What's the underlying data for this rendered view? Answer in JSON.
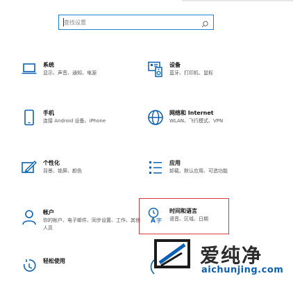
{
  "search": {
    "placeholder": "查找设置"
  },
  "tiles": [
    {
      "title": "系统",
      "desc": "显示、声音、通知、电源",
      "icon": "laptop-icon"
    },
    {
      "title": "设备",
      "desc": "蓝牙、打印机、鼠标",
      "icon": "devices-icon"
    },
    {
      "title": "手机",
      "desc": "连接 Android 设备、iPhone",
      "icon": "phone-icon"
    },
    {
      "title": "网络和 Internet",
      "desc": "WLAN、飞行模式、VPN",
      "icon": "globe-icon"
    },
    {
      "title": "个性化",
      "desc": "背景、锁屏、颜色",
      "icon": "personalization-icon"
    },
    {
      "title": "应用",
      "desc": "卸载、默认应用、可选功能",
      "icon": "apps-icon"
    },
    {
      "title": "帐户",
      "desc": "你的帐户、电子邮件、同步设置、工作、其他人员",
      "icon": "person-icon"
    },
    {
      "title": "时间和语言",
      "desc": "语音、区域、日期",
      "icon": "time-language-icon"
    },
    {
      "title": "轻松使用",
      "desc": "",
      "icon": "ease-of-access-icon"
    }
  ],
  "watermark": {
    "brand": "爱纯净",
    "url": "aichunjing.com"
  },
  "colors": {
    "accent": "#0a61b4",
    "highlight": "#d9393d",
    "search_border": "#1f7fd0"
  }
}
